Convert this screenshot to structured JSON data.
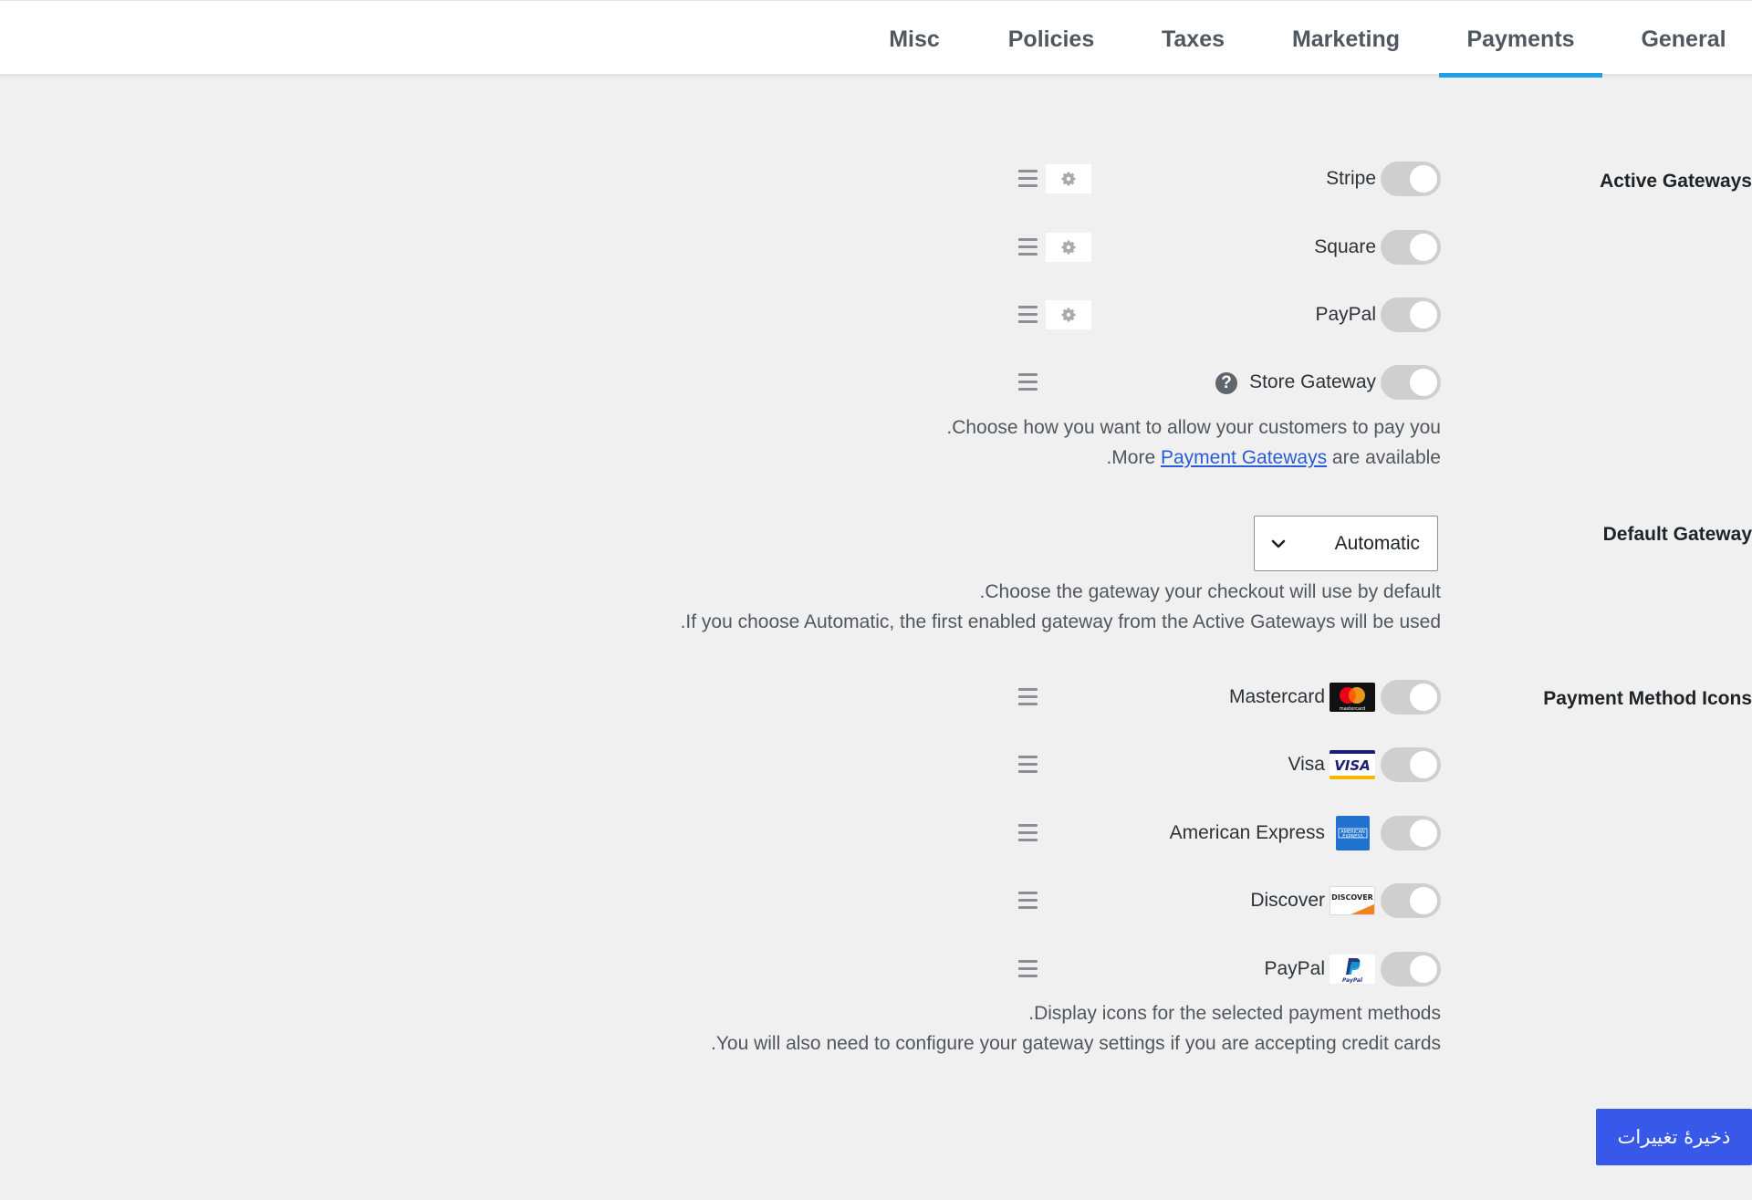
{
  "tabs": {
    "misc": "Misc",
    "policies": "Policies",
    "taxes": "Taxes",
    "marketing": "Marketing",
    "payments": "Payments",
    "general": "General"
  },
  "active_gateways": {
    "label": "Active Gateways",
    "items": [
      {
        "label": "Stripe",
        "enabled": false
      },
      {
        "label": "Square",
        "enabled": false
      },
      {
        "label": "PayPal",
        "enabled": false
      },
      {
        "label": "Store Gateway",
        "enabled": false
      }
    ],
    "help_glyph": "?",
    "desc_line1": ".Choose how you want to allow your customers to pay you",
    "desc_line2_prefix": ".More ",
    "desc_link": "Payment Gateways",
    "desc_line2_suffix": " are available"
  },
  "default_gateway": {
    "label": "Default Gateway",
    "selected": "Automatic",
    "desc_line1": ".Choose the gateway your checkout will use by default",
    "desc_line2": ".If you choose Automatic, the first enabled gateway from the Active Gateways will be used"
  },
  "payment_method_icons": {
    "label": "Payment Method Icons",
    "items": [
      {
        "label": "Mastercard",
        "icon": "mastercard-icon",
        "enabled": false
      },
      {
        "label": "Visa",
        "icon": "visa-icon",
        "enabled": false
      },
      {
        "label": "American Express",
        "icon": "amex-icon",
        "enabled": false
      },
      {
        "label": "Discover",
        "icon": "discover-icon",
        "enabled": false
      },
      {
        "label": "PayPal",
        "icon": "paypal-icon",
        "enabled": false
      }
    ],
    "card_text": {
      "mastercard": "mastercard",
      "visa": "VISA",
      "amex_line1": "AMERICAN",
      "amex_line2": "EXPRESS",
      "discover": "DISCOVER",
      "paypal": "PayPal"
    },
    "desc_line1": ".Display icons for the selected payment methods",
    "desc_line2": ".You will also need to configure your gateway settings if you are accepting credit cards"
  },
  "save_label": "ذخیرهٔ تغییرات",
  "colors": {
    "accent_tab": "#1ea0e6",
    "save_button": "#3858e9",
    "link": "#2a5bd7"
  }
}
